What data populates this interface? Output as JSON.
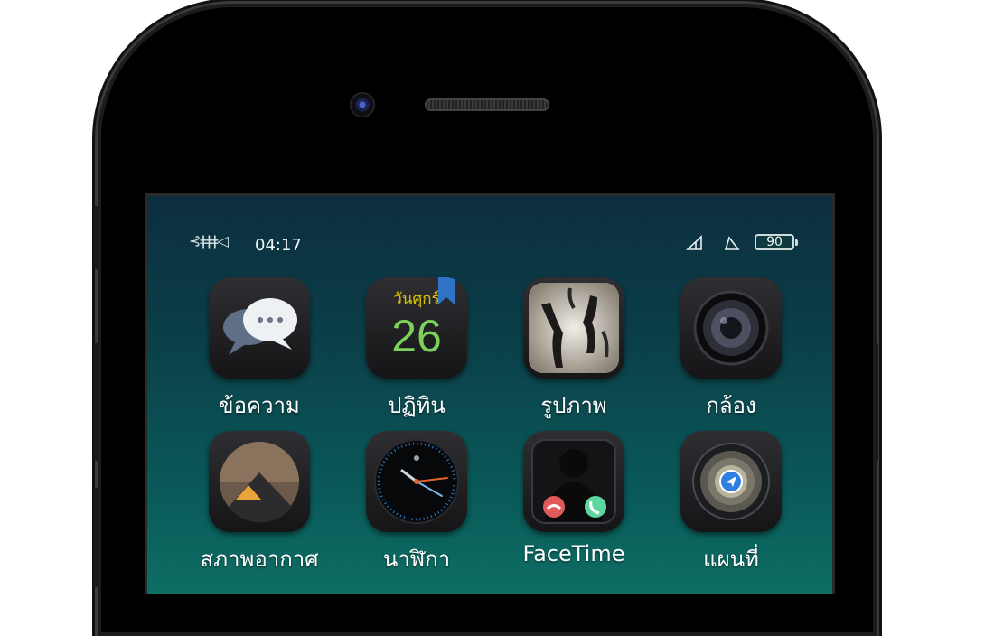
{
  "statusbar": {
    "carrier_icon": "fishbone-icon",
    "carrier_glyph": "⊰ǂǂǂ◁",
    "time": "04:17",
    "signal_icon": "signal-icon",
    "wifi_icon": "wifi-icon",
    "battery_level": "90"
  },
  "apps": [
    {
      "label": "ข้อความ",
      "icon": "messages-icon"
    },
    {
      "label": "ปฏิทิน",
      "icon": "calendar-icon",
      "day_name": "วันศุกร์",
      "day_number": "26"
    },
    {
      "label": "รูปภาพ",
      "icon": "photos-icon"
    },
    {
      "label": "กล้อง",
      "icon": "camera-icon"
    },
    {
      "label": "สภาพอากาศ",
      "icon": "weather-icon"
    },
    {
      "label": "นาฬิกา",
      "icon": "clock-icon"
    },
    {
      "label": "FaceTime",
      "icon": "facetime-icon"
    },
    {
      "label": "แผนที่",
      "icon": "maps-icon"
    }
  ],
  "colors": {
    "wallpaper_top": "#0c2e3f",
    "wallpaper_bottom": "#0d6e63",
    "calendar_day": "#e0c400",
    "calendar_number": "#7bd15a",
    "decline_red": "#e05a5a",
    "accept_green": "#5ed6a0"
  }
}
